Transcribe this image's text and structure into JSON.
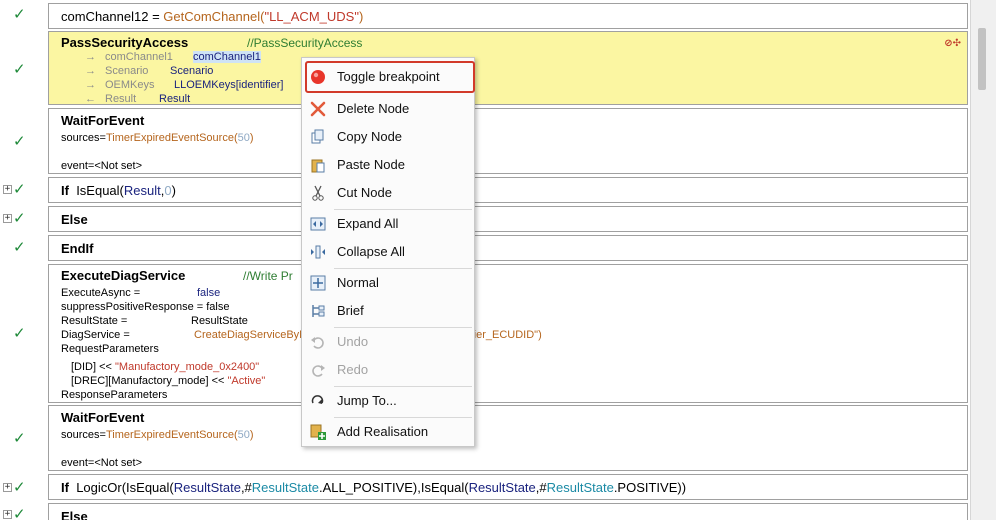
{
  "nodes": {
    "comchannel": {
      "var": "comChannel12",
      "eq": " = ",
      "fn": "GetComChannel",
      "open": "(",
      "arg": "\"LL_ACM_UDS\"",
      "close": ")"
    },
    "pass_security": {
      "title": "PassSecurityAccess",
      "comment": "//PassSecurityAccess",
      "params": [
        {
          "arrow": "→",
          "name": "comChannel1",
          "value": "comChannel1"
        },
        {
          "arrow": "→",
          "name": "Scenario",
          "value": "Scenario"
        },
        {
          "arrow": "→",
          "name": "OEMKeys",
          "value": "LLOEMKeys[identifier]"
        },
        {
          "arrow": "←",
          "name": "Result",
          "value": "Result"
        }
      ],
      "icons": "⊘✣"
    },
    "wait1": {
      "title": "WaitForEvent",
      "sources_label": "sources=",
      "sources_fn": "TimerExpiredEventSource",
      "open": "(",
      "sources_arg": "50",
      "close": ")",
      "event": "event=<Not set>"
    },
    "ifnode": {
      "kw": "If",
      "fn": "IsEqual(",
      "arg1": "Result",
      "comma": ",",
      "arg2": "0",
      "close": ")"
    },
    "else1": {
      "kw": "Else"
    },
    "endif": {
      "kw": "EndIf"
    },
    "exec": {
      "title": "ExecuteDiagService",
      "comment": "//Write Pr",
      "rows": [
        {
          "label": "ExecuteAsync =",
          "value": "false"
        },
        {
          "label": "suppressPositiveResponse = false",
          "value": ""
        },
        {
          "label": "ResultState =",
          "value": "ResultState"
        },
        {
          "label": "DiagService =",
          "value": "CreateDiagServiceByN"
        }
      ],
      "diag_tail": "ntifier_ECUDID\")",
      "req_label": "RequestParameters",
      "req_items": [
        {
          "key": "[DID] <<",
          "val": "\"Manufactory_mode_0x2400\""
        },
        {
          "key": "[DREC][Manufactory_mode] <<",
          "val": "\"Active\""
        }
      ],
      "resp_label": "ResponseParameters"
    },
    "wait2": {
      "title": "WaitForEvent",
      "sources_label": "sources=",
      "sources_fn": "TimerExpiredEventSource",
      "open": "(",
      "sources_arg": "50",
      "close": ")",
      "event": "event=<Not set>"
    },
    "if2": {
      "kw": "If",
      "p1": "LogicOr(IsEqual(",
      "a1": "ResultState",
      "p2": ",#",
      "a2": "ResultState",
      "p3": ".ALL_POSITIVE),IsEqual(",
      "a3": "ResultState",
      "p4": ",#",
      "a4": "ResultState",
      "p5": ".POSITIVE))"
    },
    "else2": {
      "kw": "Else"
    }
  },
  "context_menu": {
    "items": [
      {
        "label": "Toggle breakpoint",
        "icon": "red-dot-icon",
        "enabled": true
      },
      {
        "label": "Delete Node",
        "icon": "red-x-icon",
        "enabled": true
      },
      {
        "label": "Copy Node",
        "icon": "copy-icon",
        "enabled": true
      },
      {
        "label": "Paste Node",
        "icon": "paste-icon",
        "enabled": true
      },
      {
        "label": "Cut Node",
        "icon": "scissors-icon",
        "enabled": true
      },
      {
        "label": "Expand All",
        "icon": "expand-icon",
        "enabled": true
      },
      {
        "label": "Collapse All",
        "icon": "collapse-icon",
        "enabled": true
      },
      {
        "label": "Normal",
        "icon": "normal-view-icon",
        "enabled": true
      },
      {
        "label": "Brief",
        "icon": "brief-view-icon",
        "enabled": true
      },
      {
        "label": "Undo",
        "icon": "undo-icon",
        "enabled": false
      },
      {
        "label": "Redo",
        "icon": "redo-icon",
        "enabled": false
      },
      {
        "label": "Jump To...",
        "icon": "jump-icon",
        "enabled": true
      },
      {
        "label": "Add Realisation",
        "icon": "add-realisation-icon",
        "enabled": true
      }
    ],
    "highlighted": "Toggle breakpoint"
  },
  "colors": {
    "check": "#1f8a3a",
    "highlight_bg": "#fbf6a2",
    "focus_ring": "#d23a2a",
    "function": "#b5651d",
    "string": "#c0392b"
  }
}
